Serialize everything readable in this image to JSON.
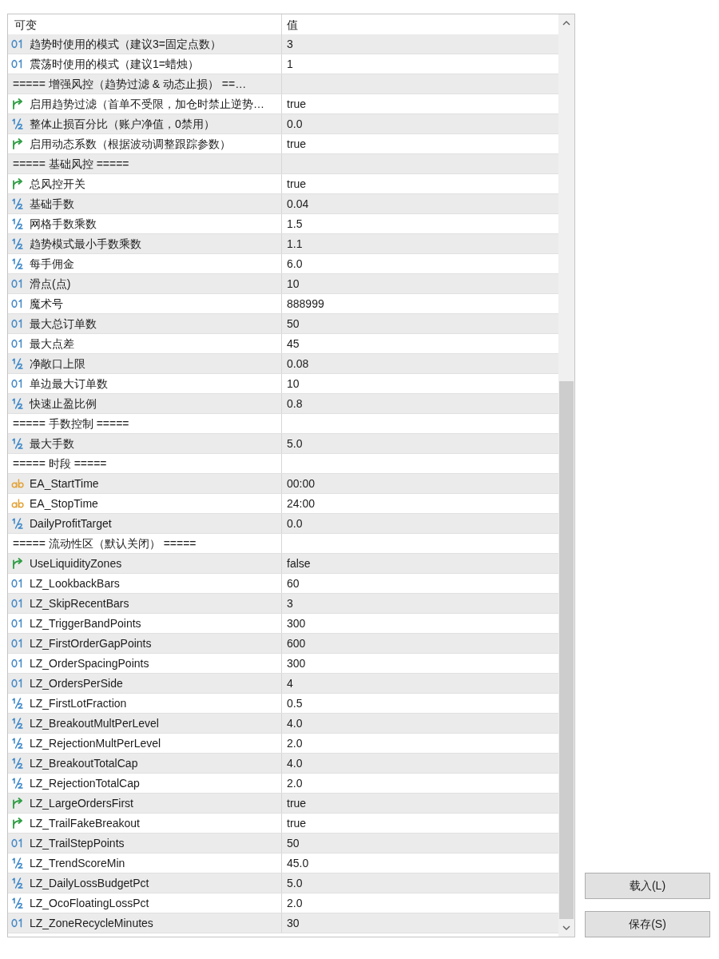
{
  "table": {
    "columns": [
      "可变",
      "值"
    ],
    "rows": [
      {
        "kind": "int",
        "name": "趋势时使用的模式（建议3=固定点数）",
        "value": "3"
      },
      {
        "kind": "int",
        "name": "震荡时使用的模式（建议1=蜡烛）",
        "value": "1"
      },
      {
        "kind": "section",
        "name": "===== 增强风控（趋势过滤 & 动态止损） ==…"
      },
      {
        "kind": "bool",
        "name": "启用趋势过滤（首单不受限，加仓时禁止逆势…",
        "value": "true"
      },
      {
        "kind": "double",
        "name": "整体止损百分比（账户净值，0禁用）",
        "value": "0.0"
      },
      {
        "kind": "bool",
        "name": "启用动态系数（根据波动调整跟踪参数）",
        "value": "true"
      },
      {
        "kind": "section",
        "name": "===== 基础风控 ====="
      },
      {
        "kind": "bool",
        "name": "总风控开关",
        "value": "true"
      },
      {
        "kind": "double",
        "name": "基础手数",
        "value": "0.04"
      },
      {
        "kind": "double",
        "name": "网格手数乘数",
        "value": "1.5"
      },
      {
        "kind": "double",
        "name": "趋势模式最小手数乘数",
        "value": "1.1"
      },
      {
        "kind": "double",
        "name": "每手佣金",
        "value": "6.0"
      },
      {
        "kind": "int",
        "name": "滑点(点)",
        "value": "10"
      },
      {
        "kind": "int",
        "name": "魔术号",
        "value": "888999"
      },
      {
        "kind": "int",
        "name": "最大总订单数",
        "value": "50"
      },
      {
        "kind": "int",
        "name": "最大点差",
        "value": "45"
      },
      {
        "kind": "double",
        "name": "净敞口上限",
        "value": "0.08"
      },
      {
        "kind": "int",
        "name": "单边最大订单数",
        "value": "10"
      },
      {
        "kind": "double",
        "name": "快速止盈比例",
        "value": "0.8"
      },
      {
        "kind": "section",
        "name": "===== 手数控制 ====="
      },
      {
        "kind": "double",
        "name": "最大手数",
        "value": "5.0"
      },
      {
        "kind": "section",
        "name": "===== 时段 ====="
      },
      {
        "kind": "string",
        "name": "EA_StartTime",
        "value": "00:00"
      },
      {
        "kind": "string",
        "name": "EA_StopTime",
        "value": "24:00"
      },
      {
        "kind": "double",
        "name": "DailyProfitTarget",
        "value": "0.0"
      },
      {
        "kind": "section",
        "name": "===== 流动性区（默认关闭） ====="
      },
      {
        "kind": "bool",
        "name": "UseLiquidityZones",
        "value": "false"
      },
      {
        "kind": "int",
        "name": "LZ_LookbackBars",
        "value": "60"
      },
      {
        "kind": "int",
        "name": "LZ_SkipRecentBars",
        "value": "3"
      },
      {
        "kind": "int",
        "name": "LZ_TriggerBandPoints",
        "value": "300"
      },
      {
        "kind": "int",
        "name": "LZ_FirstOrderGapPoints",
        "value": "600"
      },
      {
        "kind": "int",
        "name": "LZ_OrderSpacingPoints",
        "value": "300"
      },
      {
        "kind": "int",
        "name": "LZ_OrdersPerSide",
        "value": "4"
      },
      {
        "kind": "double",
        "name": "LZ_FirstLotFraction",
        "value": "0.5"
      },
      {
        "kind": "double",
        "name": "LZ_BreakoutMultPerLevel",
        "value": "4.0"
      },
      {
        "kind": "double",
        "name": "LZ_RejectionMultPerLevel",
        "value": "2.0"
      },
      {
        "kind": "double",
        "name": "LZ_BreakoutTotalCap",
        "value": "4.0"
      },
      {
        "kind": "double",
        "name": "LZ_RejectionTotalCap",
        "value": "2.0"
      },
      {
        "kind": "bool",
        "name": "LZ_LargeOrdersFirst",
        "value": "true"
      },
      {
        "kind": "bool",
        "name": "LZ_TrailFakeBreakout",
        "value": "true"
      },
      {
        "kind": "int",
        "name": "LZ_TrailStepPoints",
        "value": "50"
      },
      {
        "kind": "double",
        "name": "LZ_TrendScoreMin",
        "value": "45.0"
      },
      {
        "kind": "double",
        "name": "LZ_DailyLossBudgetPct",
        "value": "5.0"
      },
      {
        "kind": "double",
        "name": "LZ_OcoFloatingLossPct",
        "value": "2.0"
      },
      {
        "kind": "int",
        "name": "LZ_ZoneRecycleMinutes",
        "value": "30"
      }
    ]
  },
  "buttons": [
    "载入(L)",
    "保存(S)"
  ]
}
